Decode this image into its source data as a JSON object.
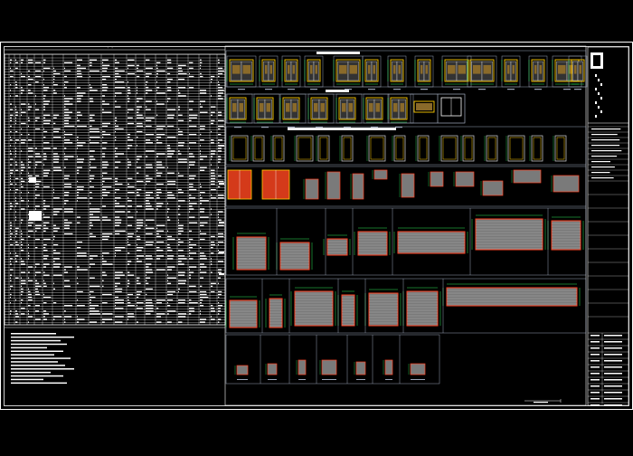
{
  "drawing": {
    "background": "#000000",
    "colors": {
      "frame": "#ffffff",
      "table_line": "#ffffff",
      "section_line": "#9aa3b5",
      "door_frame": "#ffcc00",
      "door_leaf": "#e8e8e8",
      "door_dim": "#2ee85a",
      "glass_fill": "#8a6a2a",
      "red_panel": "#d43a1a",
      "shutter_fill": "#7a7a7a",
      "shutter_edge": "#ff4020",
      "label_bar": "#3a7bd5"
    },
    "icons": [
      "title-block-logo-icon"
    ]
  }
}
